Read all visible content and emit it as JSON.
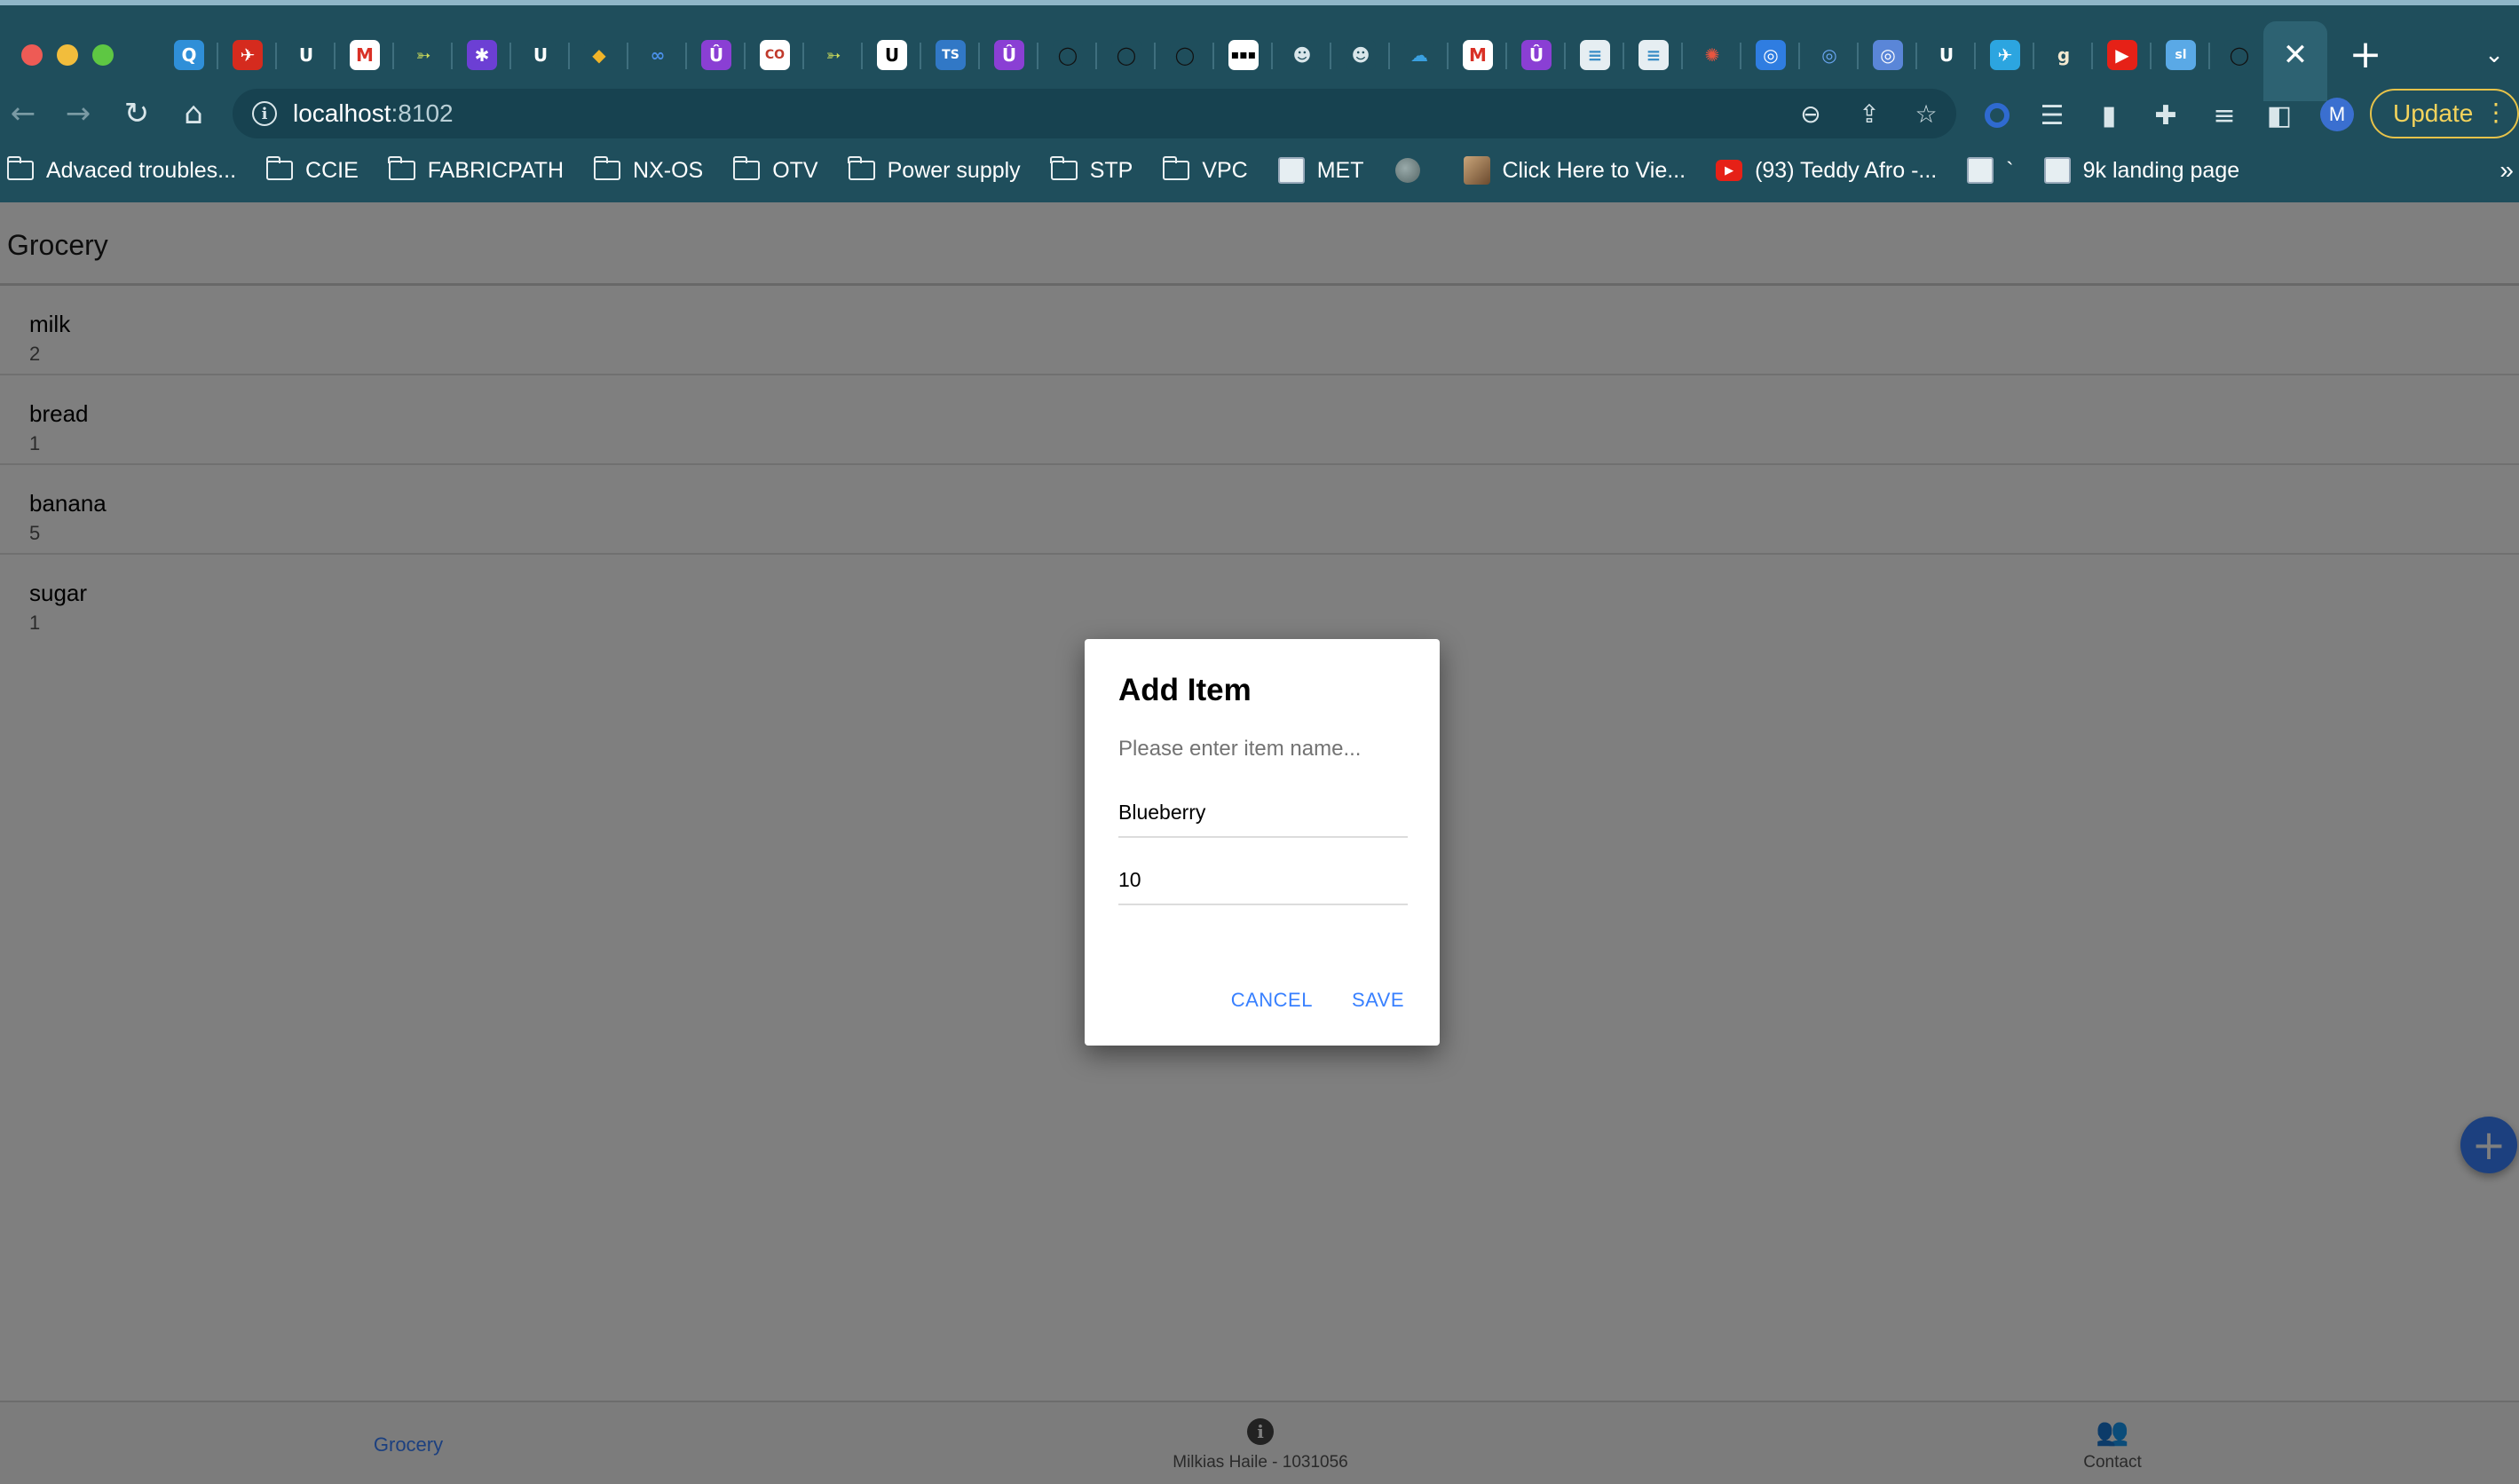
{
  "browser": {
    "url_host": "localhost",
    "url_port": ":8102",
    "update_label": "Update",
    "profile_initial": "M",
    "active_tab_close": "✕",
    "new_tab": "+",
    "tab_favicons": [
      {
        "icon": "qualys-icon",
        "glyph": "Q",
        "color": "#2f8fd8",
        "fg": "#ffffff"
      },
      {
        "icon": "turkish-airlines-icon",
        "glyph": "✈",
        "color": "#d52b1e",
        "fg": "#ffffff"
      },
      {
        "icon": "udemy-icon",
        "glyph": "U",
        "color": "#1f4e5c",
        "fg": "#ffffff"
      },
      {
        "icon": "gmail-icon",
        "glyph": "M",
        "color": "#ffffff",
        "fg": "#d93025"
      },
      {
        "icon": "arrow-icon",
        "glyph": "➳",
        "color": "#1f4e5c",
        "fg": "#c9d85a"
      },
      {
        "icon": "purple-app-icon",
        "glyph": "✱",
        "color": "#6c3fd4",
        "fg": "#ffffff"
      },
      {
        "icon": "udemy-icon",
        "glyph": "U",
        "color": "#1f4e5c",
        "fg": "#ffffff"
      },
      {
        "icon": "diamond-icon",
        "glyph": "◆",
        "color": "#1f4e5c",
        "fg": "#f0b429"
      },
      {
        "icon": "meta-icon",
        "glyph": "∞",
        "color": "#1f4e5c",
        "fg": "#4a8fe7"
      },
      {
        "icon": "udemy-purple-icon",
        "glyph": "Û",
        "color": "#8a3fd4",
        "fg": "#ffffff"
      },
      {
        "icon": "coursera-icon",
        "glyph": "CO",
        "color": "#ffffff",
        "fg": "#c0392b"
      },
      {
        "icon": "arrow-icon",
        "glyph": "➳",
        "color": "#1f4e5c",
        "fg": "#c9d85a"
      },
      {
        "icon": "udemy-white-icon",
        "glyph": "U",
        "color": "#ffffff",
        "fg": "#000000"
      },
      {
        "icon": "typescript-icon",
        "glyph": "TS",
        "color": "#3178c6",
        "fg": "#ffffff"
      },
      {
        "icon": "udemy-purple-icon",
        "glyph": "Û",
        "color": "#8a3fd4",
        "fg": "#ffffff"
      },
      {
        "icon": "github-icon",
        "glyph": "◯",
        "color": "#1f4e5c",
        "fg": "#111111"
      },
      {
        "icon": "github-icon",
        "glyph": "◯",
        "color": "#1f4e5c",
        "fg": "#111111"
      },
      {
        "icon": "github-icon",
        "glyph": "◯",
        "color": "#1f4e5c",
        "fg": "#111111"
      },
      {
        "icon": "dots-app-icon",
        "glyph": "▪▪▪",
        "color": "#ffffff",
        "fg": "#000000"
      },
      {
        "icon": "robot-icon",
        "glyph": "☻",
        "color": "#1f4e5c",
        "fg": "#d9e6ea"
      },
      {
        "icon": "robot-icon",
        "glyph": "☻",
        "color": "#1f4e5c",
        "fg": "#d9e6ea"
      },
      {
        "icon": "salesforce-icon",
        "glyph": "☁",
        "color": "#1f4e5c",
        "fg": "#3aa0e0"
      },
      {
        "icon": "gmail-icon",
        "glyph": "M",
        "color": "#ffffff",
        "fg": "#d93025"
      },
      {
        "icon": "udemy-purple-icon",
        "glyph": "Û",
        "color": "#8a3fd4",
        "fg": "#ffffff"
      },
      {
        "icon": "cisco-icon",
        "glyph": "≡",
        "color": "#e6eef2",
        "fg": "#3a8ec6"
      },
      {
        "icon": "cisco-icon",
        "glyph": "≡",
        "color": "#e6eef2",
        "fg": "#3a8ec6"
      },
      {
        "icon": "sunburst-icon",
        "glyph": "✺",
        "color": "#1f4e5c",
        "fg": "#e8553f"
      },
      {
        "icon": "target-icon",
        "glyph": "◎",
        "color": "#2f7de1",
        "fg": "#ffffff"
      },
      {
        "icon": "target-icon",
        "glyph": "◎",
        "color": "#1f4e5c",
        "fg": "#6aa6f2"
      },
      {
        "icon": "target-icon",
        "glyph": "◎",
        "color": "#5a86d8",
        "fg": "#ffffff"
      },
      {
        "icon": "udemy-icon",
        "glyph": "U",
        "color": "#1f4e5c",
        "fg": "#ffffff"
      },
      {
        "icon": "telegram-icon",
        "glyph": "✈",
        "color": "#2ca5e0",
        "fg": "#ffffff"
      },
      {
        "icon": "goodreads-icon",
        "glyph": "g",
        "color": "#1f4e5c",
        "fg": "#f4e9d0"
      },
      {
        "icon": "youtube-icon",
        "glyph": "▶",
        "color": "#e62117",
        "fg": "#ffffff"
      },
      {
        "icon": "sling-icon",
        "glyph": "sl",
        "color": "#5aa9e6",
        "fg": "#ffffff"
      },
      {
        "icon": "github-icon",
        "glyph": "◯",
        "color": "#1f4e5c",
        "fg": "#111111"
      }
    ],
    "bookmarks": [
      {
        "label": "Advaced troubles...",
        "icon": "folder-icon"
      },
      {
        "label": "CCIE",
        "icon": "folder-icon"
      },
      {
        "label": "FABRICPATH",
        "icon": "folder-icon"
      },
      {
        "label": "NX-OS",
        "icon": "folder-icon"
      },
      {
        "label": "OTV",
        "icon": "folder-icon"
      },
      {
        "label": "Power supply",
        "icon": "folder-icon"
      },
      {
        "label": "STP",
        "icon": "folder-icon"
      },
      {
        "label": "VPC",
        "icon": "folder-icon"
      },
      {
        "label": "MET",
        "icon": "cisco-icon"
      },
      {
        "label": "",
        "icon": "globe-icon"
      },
      {
        "label": "Click Here to Vie...",
        "icon": "photo-icon"
      },
      {
        "label": "(93) Teddy Afro -...",
        "icon": "youtube-icon"
      },
      {
        "label": "`",
        "icon": "cisco-icon"
      },
      {
        "label": "9k landing page",
        "icon": "cisco-icon"
      }
    ],
    "bookmarks_more": "»"
  },
  "app": {
    "title": "Grocery",
    "items": [
      {
        "name": "milk",
        "quantity": "2"
      },
      {
        "name": "bread",
        "quantity": "1"
      },
      {
        "name": "banana",
        "quantity": "5"
      },
      {
        "name": "sugar",
        "quantity": "1"
      }
    ],
    "tabbar": {
      "grocery_label": "Grocery",
      "about_label": "Milkias Haile - 1031056",
      "contact_label": "Contact"
    },
    "fab_label": "+"
  },
  "dialog": {
    "title": "Add Item",
    "message": "Please enter item name...",
    "name_value": "Blueberry",
    "quantity_value": "10",
    "cancel_label": "CANCEL",
    "save_label": "SAVE"
  },
  "colors": {
    "chrome_bg": "#1f4e5c",
    "accent": "#3880ff",
    "update_yellow": "#f3d35c"
  }
}
